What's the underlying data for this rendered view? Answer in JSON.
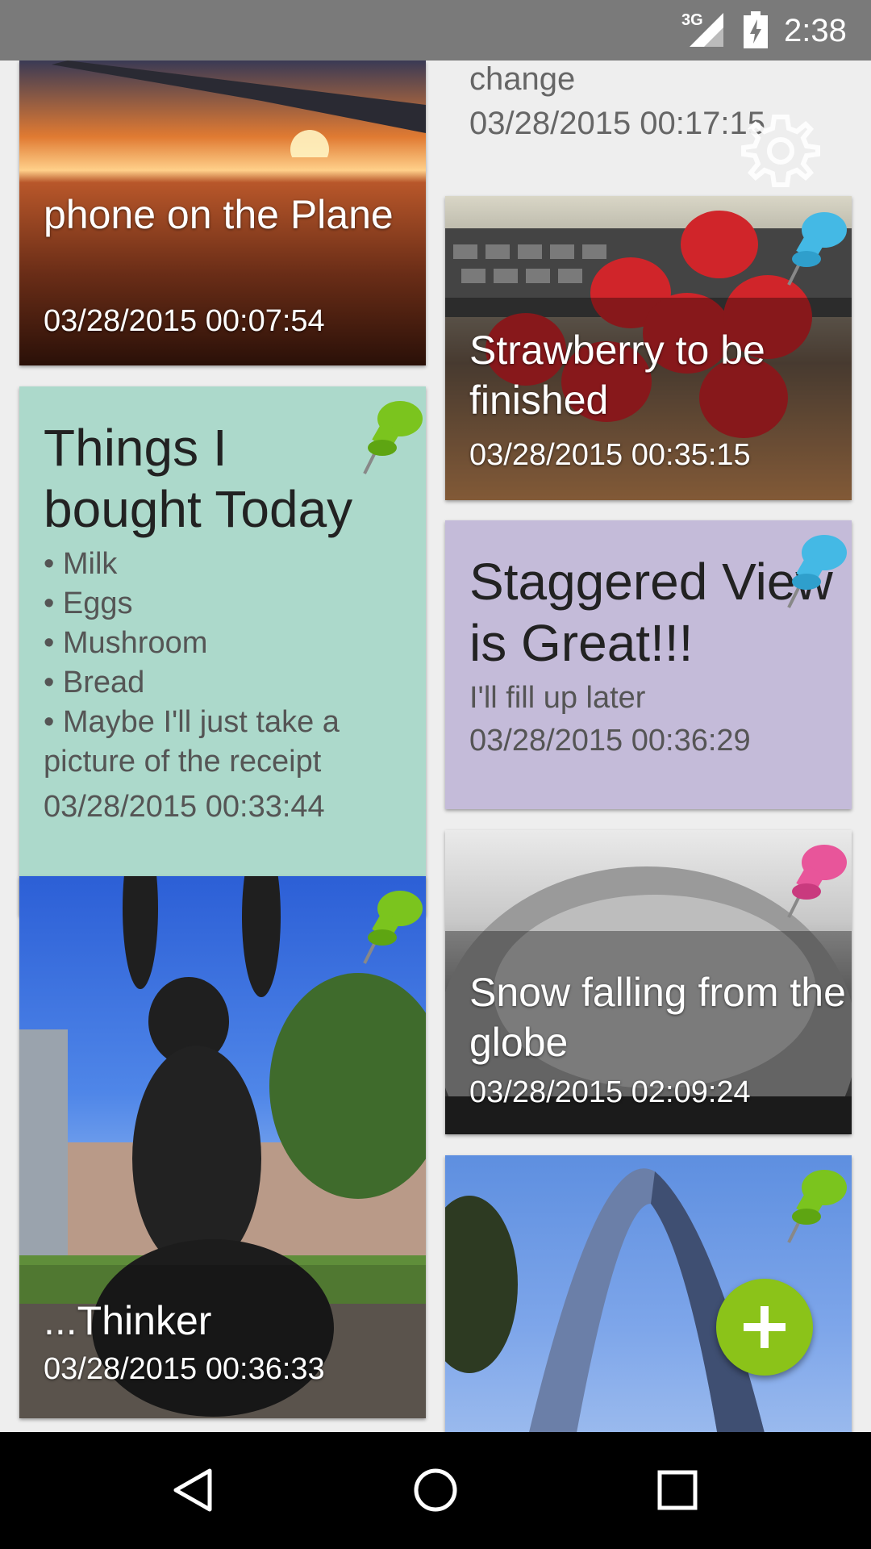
{
  "status_bar": {
    "network": "3G",
    "time": "2:38"
  },
  "notes": [
    {
      "id": "plane",
      "title": "phone on the Plane",
      "date": "03/28/2015 00:07:54"
    },
    {
      "id": "change",
      "title": "change",
      "date": "03/28/2015 00:17:15"
    },
    {
      "id": "strawberry",
      "title": "Strawberry to be finished",
      "date": "03/28/2015 00:35:15",
      "pin_color": "#44b9e5"
    },
    {
      "id": "things",
      "title": "Things I bought Today",
      "items": [
        "• Milk",
        "• Eggs",
        "• Mushroom",
        "• Bread",
        "• Maybe I'll just take a",
        "picture of the receipt"
      ],
      "date": "03/28/2015 00:33:44",
      "bg": "#acd9cb",
      "pin_color": "#7bc41e"
    },
    {
      "id": "staggered",
      "title": "Staggered View is Great!!!",
      "body": "I'll fill up later",
      "date": "03/28/2015 00:36:29",
      "bg": "#c4bbd9",
      "pin_color": "#44b9e5"
    },
    {
      "id": "snow",
      "title": "Snow falling from the globe",
      "date": "03/28/2015 02:09:24",
      "pin_color": "#e8559a"
    },
    {
      "id": "thinker",
      "title": "...Thinker",
      "date": "03/28/2015 00:36:33",
      "pin_color": "#7bc41e"
    },
    {
      "id": "arch",
      "pin_color": "#7bc41e"
    }
  ],
  "icons": {
    "settings": "gear-icon",
    "add": "plus-icon",
    "nav_back": "back-triangle-icon",
    "nav_home": "home-circle-icon",
    "nav_recents": "recents-square-icon"
  },
  "colors": {
    "fab": "#8bc319",
    "status_bar": "#7a7a7a",
    "background": "#eeeeee"
  }
}
